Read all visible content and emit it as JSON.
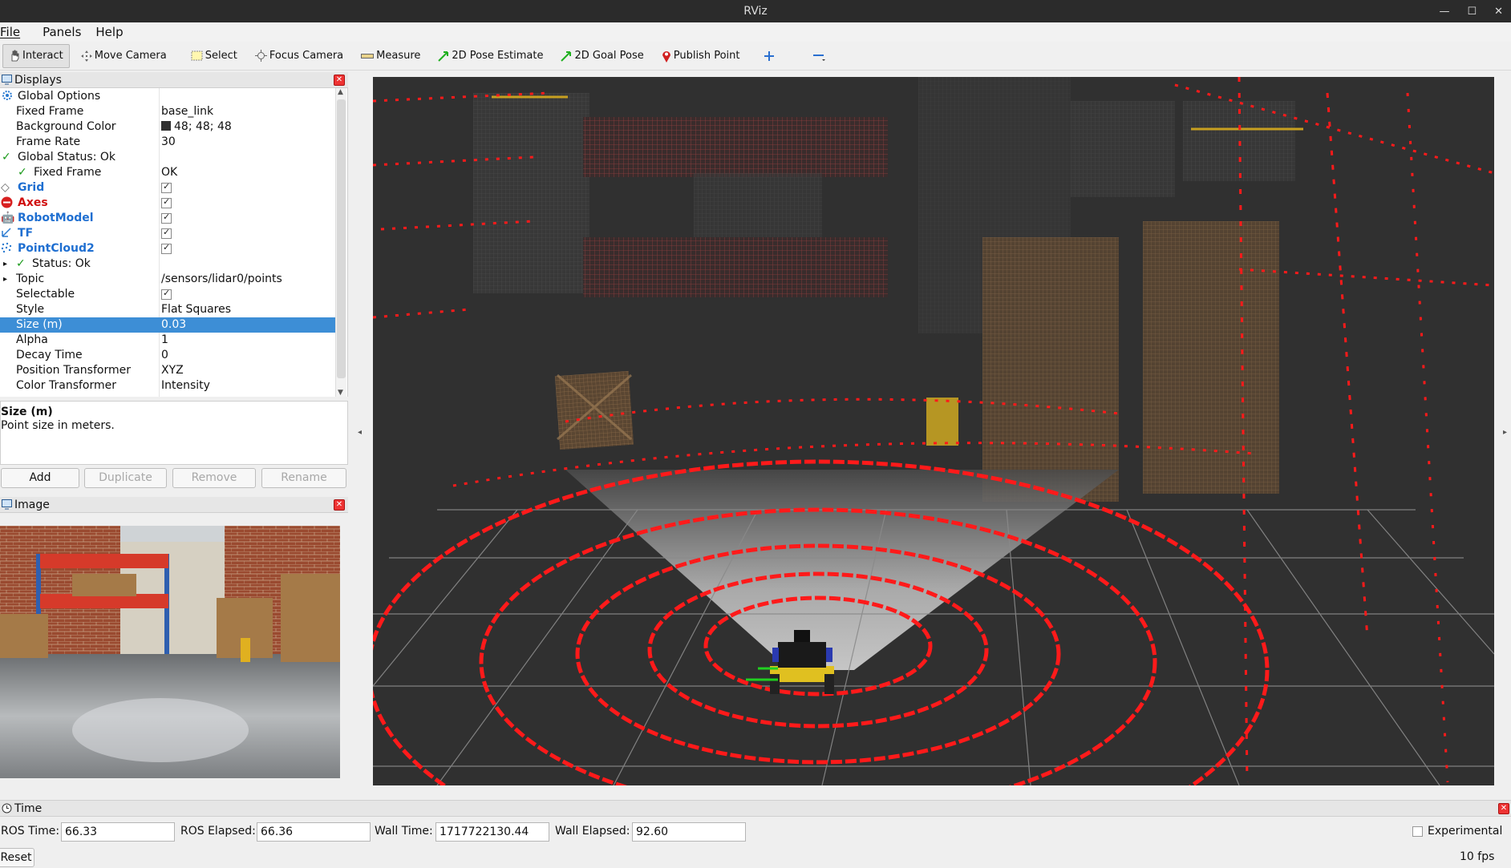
{
  "window": {
    "title": "RViz"
  },
  "menu": [
    "File",
    "Panels",
    "Help"
  ],
  "toolbar": {
    "tools": [
      "Interact",
      "Move Camera",
      "Select",
      "Focus Camera",
      "Measure",
      "2D Pose Estimate",
      "2D Goal Pose",
      "Publish Point"
    ],
    "active_tool": "Interact"
  },
  "displays": {
    "title": "Displays",
    "rows": [
      {
        "label": "Global Options",
        "value": ""
      },
      {
        "label": "Fixed Frame",
        "value": "base_link"
      },
      {
        "label": "Background Color",
        "value": "48; 48; 48"
      },
      {
        "label": "Frame Rate",
        "value": "30"
      },
      {
        "label": "Global Status: Ok",
        "value": ""
      },
      {
        "label": "Fixed Frame",
        "value": "OK"
      },
      {
        "label": "Grid",
        "value": ""
      },
      {
        "label": "Axes",
        "value": ""
      },
      {
        "label": "RobotModel",
        "value": ""
      },
      {
        "label": "TF",
        "value": ""
      },
      {
        "label": "PointCloud2",
        "value": ""
      },
      {
        "label": "Status: Ok",
        "value": ""
      },
      {
        "label": "Topic",
        "value": "/sensors/lidar0/points"
      },
      {
        "label": "Selectable",
        "value": ""
      },
      {
        "label": "Style",
        "value": "Flat Squares"
      },
      {
        "label": "Size (m)",
        "value": "0.03"
      },
      {
        "label": "Alpha",
        "value": "1"
      },
      {
        "label": "Decay Time",
        "value": "0"
      },
      {
        "label": "Position Transformer",
        "value": "XYZ"
      },
      {
        "label": "Color Transformer",
        "value": "Intensity"
      }
    ],
    "selected_row": "Size (m)",
    "description_title": "Size (m)",
    "description_text": "Point size in meters."
  },
  "buttons": {
    "add": "Add",
    "duplicate": "Duplicate",
    "remove": "Remove",
    "rename": "Rename"
  },
  "image_panel": {
    "title": "Image"
  },
  "time_panel": {
    "title": "Time",
    "ros_time_label": "ROS Time:",
    "ros_time": "66.33",
    "ros_elapsed_label": "ROS Elapsed:",
    "ros_elapsed": "66.36",
    "wall_time_label": "Wall Time:",
    "wall_time": "1717722130.44",
    "wall_elapsed_label": "Wall Elapsed:",
    "wall_elapsed": "92.60",
    "experimental_label": "Experimental",
    "reset_label": "Reset",
    "fps": "10 fps"
  },
  "colors": {
    "accent": "#3d8ed6",
    "pointcloud": "#ff1a1a",
    "background": "#303030"
  }
}
